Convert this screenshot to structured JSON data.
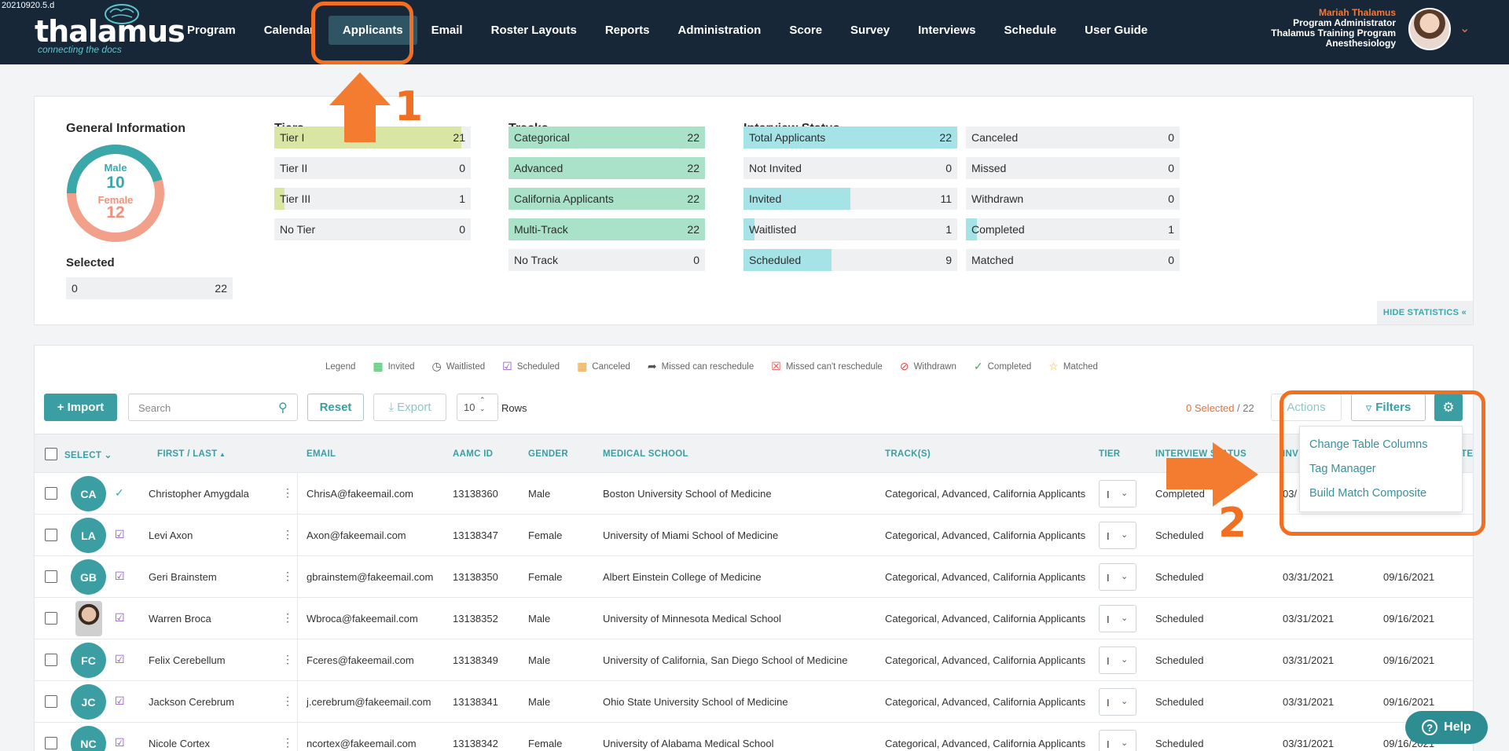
{
  "version": "20210920.5.d",
  "logo": {
    "word": "thalamus",
    "tagline": "connecting the docs"
  },
  "nav": [
    "Program",
    "Calendar",
    "Applicants",
    "Email",
    "Roster Layouts",
    "Reports",
    "Administration",
    "Score",
    "Survey",
    "Interviews",
    "Schedule",
    "User Guide"
  ],
  "nav_active": "Applicants",
  "user": {
    "name": "Mariah Thalamus",
    "role": "Program Administrator",
    "program": "Thalamus Training Program",
    "specialty": "Anesthesiology"
  },
  "annotations": {
    "step1": "1",
    "step2": "2"
  },
  "stats": {
    "general": {
      "title": "General Information",
      "male_label": "Male",
      "male_value": "10",
      "female_label": "Female",
      "female_value": "12",
      "male_count": 10,
      "female_count": 12
    },
    "selected": {
      "title": "Selected",
      "value": "0",
      "total": "22"
    },
    "tiers": {
      "title": "Tiers",
      "items": [
        {
          "label": "Tier I",
          "value": "21",
          "fraction": 0.95
        },
        {
          "label": "Tier II",
          "value": "0",
          "fraction": 0
        },
        {
          "label": "Tier III",
          "value": "1",
          "fraction": 0.05
        },
        {
          "label": "No Tier",
          "value": "0",
          "fraction": 0
        }
      ]
    },
    "tracks": {
      "title": "Tracks",
      "items": [
        {
          "label": "Categorical",
          "value": "22",
          "fraction": 1
        },
        {
          "label": "Advanced",
          "value": "22",
          "fraction": 1
        },
        {
          "label": "California Applicants",
          "value": "22",
          "fraction": 1
        },
        {
          "label": "Multi-Track",
          "value": "22",
          "fraction": 1
        },
        {
          "label": "No Track",
          "value": "0",
          "fraction": 0
        }
      ]
    },
    "interview_status": {
      "title": "Interview Status",
      "left": [
        {
          "label": "Total Applicants",
          "value": "22",
          "fraction": 1
        },
        {
          "label": "Not Invited",
          "value": "0",
          "fraction": 0
        },
        {
          "label": "Invited",
          "value": "11",
          "fraction": 0.5
        },
        {
          "label": "Waitlisted",
          "value": "1",
          "fraction": 0.045
        },
        {
          "label": "Scheduled",
          "value": "9",
          "fraction": 0.41
        }
      ],
      "right": [
        {
          "label": "Canceled",
          "value": "0",
          "fraction": 0
        },
        {
          "label": "Missed",
          "value": "0",
          "fraction": 0
        },
        {
          "label": "Withdrawn",
          "value": "0",
          "fraction": 0
        },
        {
          "label": "Completed",
          "value": "1",
          "fraction": 0.045
        },
        {
          "label": "Matched",
          "value": "0",
          "fraction": 0
        }
      ]
    },
    "hide_label": "HIDE STATISTICS «"
  },
  "legend": {
    "title": "Legend",
    "items": [
      {
        "label": "Invited",
        "icon": "calendar-plus-icon",
        "color": "#3cae5e"
      },
      {
        "label": "Waitlisted",
        "icon": "clock-icon",
        "color": "#555555"
      },
      {
        "label": "Scheduled",
        "icon": "calendar-check-icon",
        "color": "#8a4fc9"
      },
      {
        "label": "Canceled",
        "icon": "calendar-icon",
        "color": "#f0a040"
      },
      {
        "label": "Missed can reschedule",
        "icon": "share-icon",
        "color": "#555555"
      },
      {
        "label": "Missed can't reschedule",
        "icon": "calendar-x-icon",
        "color": "#e04848"
      },
      {
        "label": "Withdrawn",
        "icon": "ban-icon",
        "color": "#e04848"
      },
      {
        "label": "Completed",
        "icon": "check-icon",
        "color": "#3cae5e"
      },
      {
        "label": "Matched",
        "icon": "star-icon",
        "color": "#f0b840"
      }
    ]
  },
  "toolbar": {
    "import": "+ Import",
    "search_placeholder": "Search",
    "reset": "Reset",
    "export": "Export",
    "rows_value": "10",
    "rows_label": "Rows",
    "selected": "0 Selected",
    "selected_total": " / 22",
    "actions": "Actions",
    "filters": "Filters"
  },
  "settings_menu": [
    "Change Table Columns",
    "Tag Manager",
    "Build Match Composite"
  ],
  "table": {
    "headers": {
      "select": "SELECT",
      "name": "FIRST / LAST",
      "email": "EMAIL",
      "aamc": "AAMC ID",
      "gender": "GENDER",
      "school": "MEDICAL SCHOOL",
      "tracks": "TRACK(S)",
      "tier": "TIER",
      "status": "INTERVIEW STATUS",
      "inv": "INV",
      "last": "TE"
    },
    "rows": [
      {
        "initials": "CA",
        "name": "Christopher Amygdala",
        "email": "ChrisA@fakeemail.com",
        "aamc": "13138360",
        "gender": "Male",
        "school": "Boston University School of Medicine",
        "tracks": "Categorical, Advanced, California Applicants",
        "tier": "I",
        "status": "Completed",
        "date1": "03/",
        "date2": "",
        "status_icon": "completed",
        "photo": false
      },
      {
        "initials": "LA",
        "name": "Levi Axon",
        "email": "Axon@fakeemail.com",
        "aamc": "13138347",
        "gender": "Female",
        "school": "University of Miami School of Medicine",
        "tracks": "Categorical, Advanced, California Applicants",
        "tier": "I",
        "status": "Scheduled",
        "date1": "",
        "date2": "",
        "status_icon": "scheduled",
        "photo": false
      },
      {
        "initials": "GB",
        "name": "Geri Brainstem",
        "email": "gbrainstem@fakeemail.com",
        "aamc": "13138350",
        "gender": "Female",
        "school": "Albert Einstein College of Medicine",
        "tracks": "Categorical, Advanced, California Applicants",
        "tier": "I",
        "status": "Scheduled",
        "date1": "03/31/2021",
        "date2": "09/16/2021",
        "status_icon": "scheduled",
        "photo": false
      },
      {
        "initials": "WB",
        "name": "Warren Broca",
        "email": "Wbroca@fakeemail.com",
        "aamc": "13138352",
        "gender": "Male",
        "school": "University of Minnesota Medical School",
        "tracks": "Categorical, Advanced, California Applicants",
        "tier": "I",
        "status": "Scheduled",
        "date1": "03/31/2021",
        "date2": "09/16/2021",
        "status_icon": "scheduled",
        "photo": true
      },
      {
        "initials": "FC",
        "name": "Felix Cerebellum",
        "email": "Fceres@fakeemail.com",
        "aamc": "13138349",
        "gender": "Male",
        "school": "University of California, San Diego School of Medicine",
        "tracks": "Categorical, Advanced, California Applicants",
        "tier": "I",
        "status": "Scheduled",
        "date1": "03/31/2021",
        "date2": "09/16/2021",
        "status_icon": "scheduled",
        "photo": false
      },
      {
        "initials": "JC",
        "name": "Jackson Cerebrum",
        "email": "j.cerebrum@fakeemail.com",
        "aamc": "13138341",
        "gender": "Male",
        "school": "Ohio State University School of Medicine",
        "tracks": "Categorical, Advanced, California Applicants",
        "tier": "I",
        "status": "Scheduled",
        "date1": "03/31/2021",
        "date2": "09/16/2021",
        "status_icon": "scheduled",
        "photo": false
      },
      {
        "initials": "NC",
        "name": "Nicole Cortex",
        "email": "ncortex@fakeemail.com",
        "aamc": "13138342",
        "gender": "Female",
        "school": "University of Alabama Medical School",
        "tracks": "Categorical, Advanced, California Applicants",
        "tier": "I",
        "status": "Scheduled",
        "date1": "03/31/2021",
        "date2": "09/16/2021",
        "status_icon": "scheduled",
        "photo": false
      }
    ]
  },
  "help": "Help",
  "colors": {
    "nav_bg": "#172738",
    "accent": "#3a9ea3",
    "annotation": "#f26f22",
    "tier_fill": "#d9e6a3",
    "track_fill": "#a9e2c9",
    "status_fill": "#a6e3e6"
  }
}
